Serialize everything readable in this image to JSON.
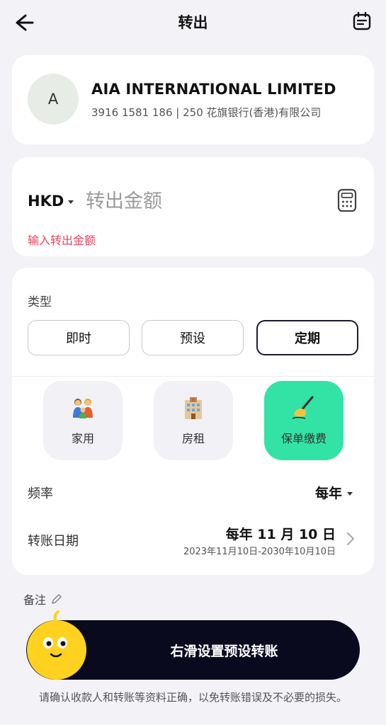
{
  "header": {
    "title": "转出",
    "back_icon": "arrow-left-icon",
    "calendar_icon": "calendar-icon"
  },
  "payee": {
    "avatar_letter": "A",
    "name": "AIA INTERNATIONAL LIMITED",
    "account": "3916 1581 186 | 250 花旗银行(香港)有限公司"
  },
  "amount": {
    "currency": "HKD",
    "placeholder": "转出金额",
    "error": "输入转出金额",
    "calculator_icon": "calculator-icon"
  },
  "transfer_type": {
    "label": "类型",
    "options": [
      "即时",
      "预设",
      "定期"
    ],
    "selected": "定期"
  },
  "categories": [
    {
      "label": "家用",
      "icon": "family-icon",
      "selected": false
    },
    {
      "label": "房租",
      "icon": "building-icon",
      "selected": false
    },
    {
      "label": "保单缴费",
      "icon": "writing-hand-icon",
      "selected": true
    }
  ],
  "frequency": {
    "label": "频率",
    "value": "每年"
  },
  "transfer_date": {
    "label": "转账日期",
    "value": "每年 11 月 10 日",
    "range": "2023年11月10日-2030年10月10日"
  },
  "note": {
    "label": "备注"
  },
  "slider": {
    "label": "右滑设置预设转账"
  },
  "disclaimer": "请确认收款人和转账等资料正确，以免转账错误及不必要的损失。",
  "colors": {
    "accent_green": "#33e3a6",
    "error_red": "#e8455d",
    "slider_bg": "#0a0a1f",
    "knob_yellow": "#ffd21f"
  }
}
